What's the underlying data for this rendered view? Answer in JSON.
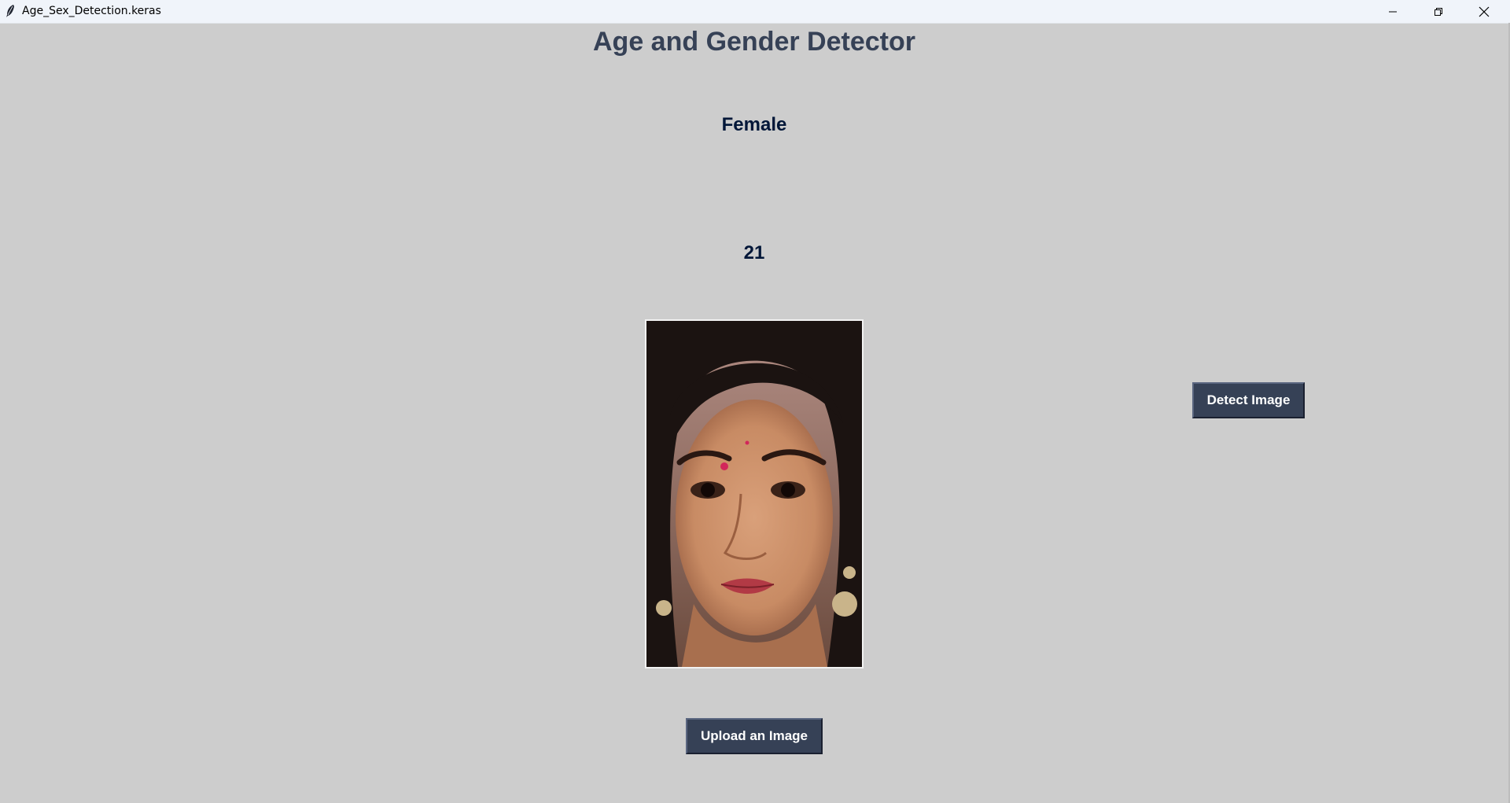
{
  "window": {
    "title": "Age_Sex_Detection.keras",
    "icon": "feather-icon",
    "controls": [
      "minimize-icon",
      "restore-icon",
      "close-icon"
    ]
  },
  "app": {
    "heading": "Age and Gender Detector",
    "gender_result": "Female",
    "age_result": "21",
    "detect_button_label": "Detect Image",
    "upload_button_label": "Upload an Image"
  },
  "colors": {
    "background": "#cdcdcd",
    "heading": "#364156",
    "result_text": "#011638",
    "button_bg": "#364156",
    "button_text": "#ffffff"
  }
}
